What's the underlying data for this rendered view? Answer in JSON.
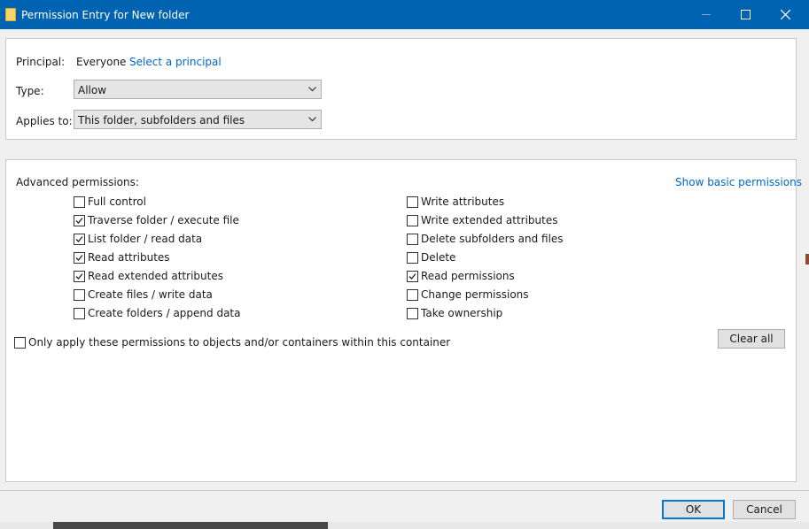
{
  "window": {
    "title": "Permission Entry for New folder"
  },
  "principal": {
    "label": "Principal:",
    "value": "Everyone",
    "select_link": "Select a principal"
  },
  "type": {
    "label": "Type:",
    "value": "Allow"
  },
  "applies_to": {
    "label": "Applies to:",
    "value": "This folder, subfolders and files"
  },
  "permissions": {
    "heading": "Advanced permissions:",
    "toggle_link": "Show basic permissions",
    "left": [
      {
        "label": "Full control",
        "checked": false
      },
      {
        "label": "Traverse folder / execute file",
        "checked": true
      },
      {
        "label": "List folder / read data",
        "checked": true
      },
      {
        "label": "Read attributes",
        "checked": true
      },
      {
        "label": "Read extended attributes",
        "checked": true
      },
      {
        "label": "Create files / write data",
        "checked": false
      },
      {
        "label": "Create folders / append data",
        "checked": false
      }
    ],
    "right": [
      {
        "label": "Write attributes",
        "checked": false
      },
      {
        "label": "Write extended attributes",
        "checked": false
      },
      {
        "label": "Delete subfolders and files",
        "checked": false
      },
      {
        "label": "Delete",
        "checked": false
      },
      {
        "label": "Read permissions",
        "checked": true
      },
      {
        "label": "Change permissions",
        "checked": false
      },
      {
        "label": "Take ownership",
        "checked": false
      }
    ],
    "only_apply": {
      "label": "Only apply these permissions to objects and/or containers within this container",
      "checked": false
    },
    "clear_all": "Clear all"
  },
  "footer": {
    "ok": "OK",
    "cancel": "Cancel"
  },
  "colors": {
    "titlebar": "#0063b1",
    "link": "#0066cc",
    "focus": "#0078d7"
  }
}
